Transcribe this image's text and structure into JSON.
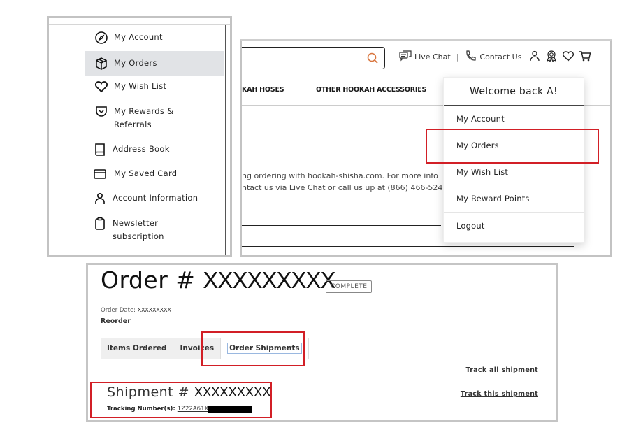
{
  "sidebar": {
    "items": [
      {
        "label": "My Account",
        "icon": "compass-icon",
        "active": false
      },
      {
        "label": "My Orders",
        "icon": "box-icon",
        "active": true
      },
      {
        "label": "My Wish List",
        "icon": "heart-icon",
        "active": false
      },
      {
        "label": "My Rewards &",
        "label2": "Referrals",
        "icon": "pocket-icon",
        "active": false
      },
      {
        "label": "Address Book",
        "icon": "book-icon",
        "active": false
      },
      {
        "label": "My Saved Card",
        "icon": "card-icon",
        "active": false
      },
      {
        "label": "Account Information",
        "icon": "user-icon",
        "active": false
      },
      {
        "label": "Newsletter",
        "label2": "subscription",
        "icon": "clipboard-icon",
        "active": false
      }
    ]
  },
  "header": {
    "live_chat": "Live Chat",
    "separator": "|",
    "contact_us": "Contact Us",
    "nav": [
      "KAH HOSES",
      "OTHER HOOKAH ACCESSORIES"
    ],
    "body_line1": "ng ordering with hookah-shisha.com. For more info",
    "body_line2": "ntact us via Live Chat or call us up at (866) 466-524",
    "search_icon_color": "#d9763f"
  },
  "dropdown": {
    "welcome": "Welcome back A!",
    "items": [
      "My Account",
      "My Orders",
      "My Wish List",
      "My Reward Points"
    ],
    "logout": "Logout"
  },
  "order": {
    "title_prefix": "Order #",
    "number": "XXXXXXXXX",
    "status": "COMPLETE",
    "date_label": "Order Date:",
    "date_value": "XXXXXXXXX",
    "reorder": "Reorder",
    "tabs": [
      "Items Ordered",
      "Invoices",
      "Order Shipments"
    ],
    "active_tab": "Order Shipments",
    "track_all": "Track all shipment",
    "track_this": "Track this shipment",
    "shipment_prefix": "Shipment #",
    "shipment_number": "XXXXXXXXX",
    "tracking_label": "Tracking Number(s):",
    "tracking_value": "1Z22A61X"
  },
  "highlight_color": "#d21f26"
}
